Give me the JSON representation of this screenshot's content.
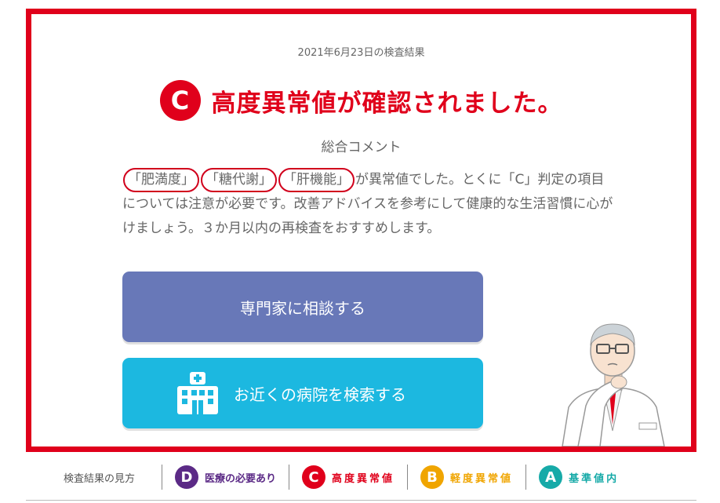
{
  "result": {
    "date": "2021年6月23日の検査結果",
    "grade": "C",
    "message": "高度異常値が確認されました。",
    "grade_color": "#e0001b"
  },
  "comment": {
    "heading": "総合コメント",
    "highlights": [
      "「肥満度」",
      "「糖代謝」",
      "「肝機能」"
    ],
    "text_after_highlights": "が異常値でした。とくに「C」判定の項目については注意が必要です。改善アドバイスを参考にして健康的な生活習慣に心がけましょう。３か月以内の再検査をおすすめします。"
  },
  "buttons": {
    "consult_label": "専門家に相談する",
    "consult_color": "#6878b8",
    "hospital_label": "お近くの病院を検索する",
    "hospital_color": "#1cb8e0",
    "hospital_icon": "hospital-icon"
  },
  "legend": {
    "title": "検査結果の見方",
    "items": [
      {
        "grade": "D",
        "label": "医療の必要あり",
        "color": "#5b2a86"
      },
      {
        "grade": "C",
        "label": "高度異常値",
        "color": "#e0001b"
      },
      {
        "grade": "B",
        "label": "軽度異常値",
        "color": "#f0a500"
      },
      {
        "grade": "A",
        "label": "基準値内",
        "color": "#16aaa8"
      }
    ]
  },
  "illustration": "doctor-thinking"
}
